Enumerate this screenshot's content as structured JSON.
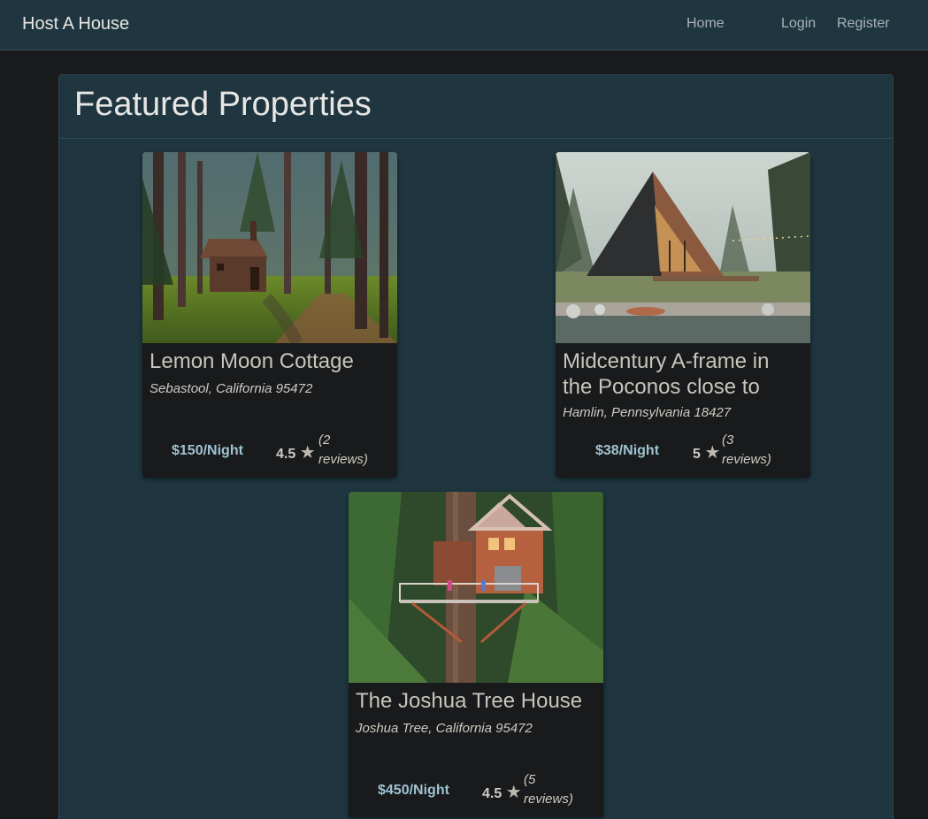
{
  "navbar": {
    "brand": "Host A House",
    "links": [
      "Home",
      "Login",
      "Register"
    ]
  },
  "panel": {
    "title": "Featured Properties"
  },
  "properties": [
    {
      "name": "Lemon Moon Cottage",
      "location": "Sebastool, California 95472",
      "price": "$150/Night",
      "rating": "4.5",
      "reviews_open": "(2",
      "reviews_close": "reviews)"
    },
    {
      "name": "Midcentury A-frame in the Poconos close to",
      "location": "Hamlin, Pennsylvania 18427",
      "price": "$38/Night",
      "rating": "5",
      "reviews_open": "(3",
      "reviews_close": "reviews)"
    },
    {
      "name": "The Joshua Tree House",
      "location": "Joshua Tree, California 95472",
      "price": "$450/Night",
      "rating": "4.5",
      "reviews_open": "(5",
      "reviews_close": "reviews)"
    }
  ],
  "icons": {
    "star": "star-icon"
  },
  "colors": {
    "navbar_bg": "#1f3640",
    "page_bg": "#181a1b",
    "price": "#9fc3d2"
  }
}
